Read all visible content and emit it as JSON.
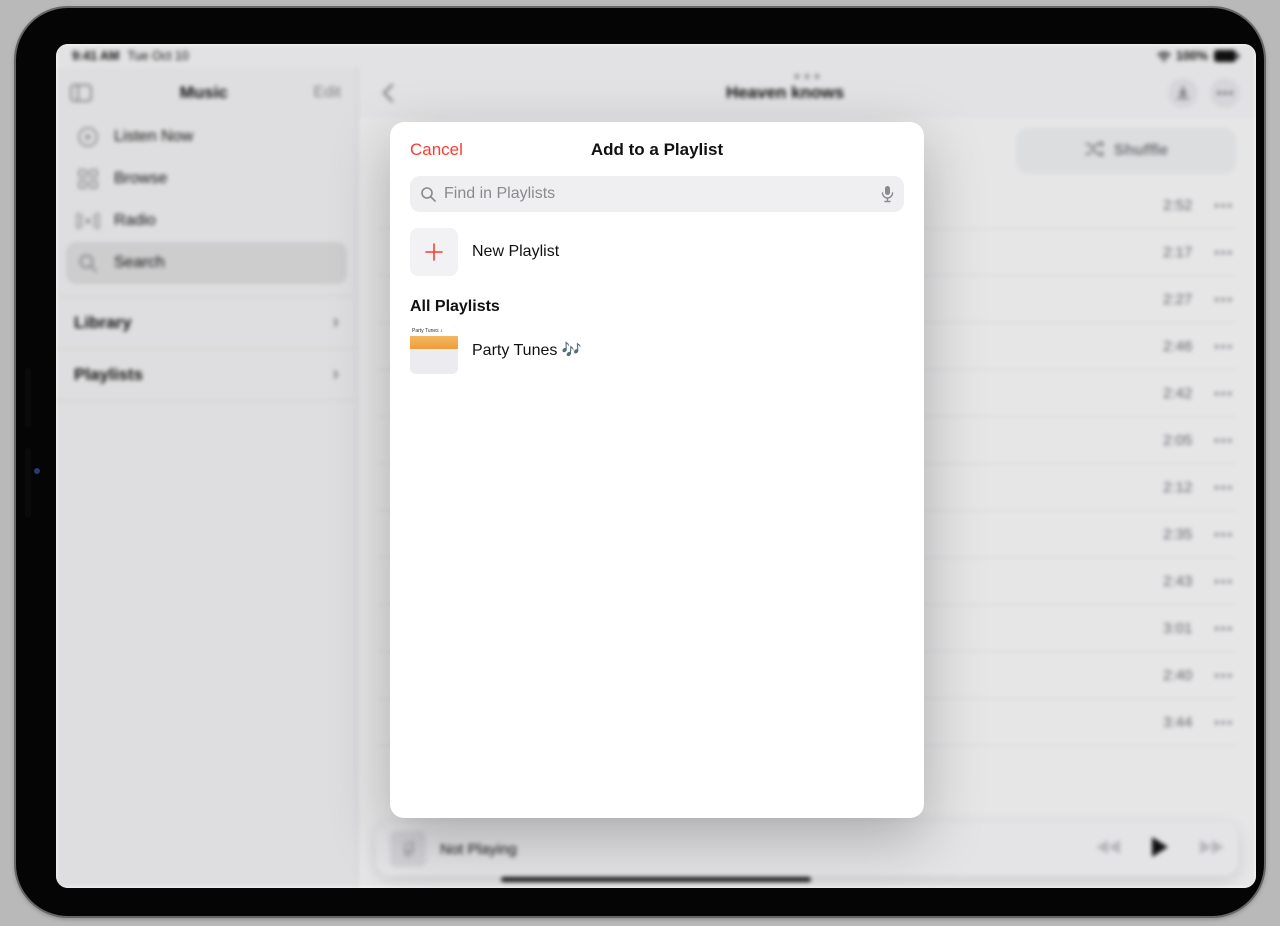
{
  "status": {
    "time": "9:41 AM",
    "date": "Tue Oct 10",
    "battery_pct": "100%"
  },
  "sidebar": {
    "title": "Music",
    "edit_label": "Edit",
    "items": [
      {
        "label": "Listen Now"
      },
      {
        "label": "Browse"
      },
      {
        "label": "Radio"
      },
      {
        "label": "Search"
      }
    ],
    "library_label": "Library",
    "playlists_label": "Playlists"
  },
  "content": {
    "title": "Heaven knows",
    "shuffle_label": "Shuffle"
  },
  "tracks": [
    {
      "duration": "2:52"
    },
    {
      "duration": "2:17"
    },
    {
      "duration": "2:27"
    },
    {
      "duration": "2:46"
    },
    {
      "duration": "2:42"
    },
    {
      "duration": "2:05"
    },
    {
      "duration": "2:12"
    },
    {
      "duration": "2:35"
    },
    {
      "duration": "2:43"
    },
    {
      "duration": "3:01"
    },
    {
      "duration": "2:40"
    },
    {
      "duration": "3:44"
    }
  ],
  "nowplaying": {
    "label": "Not Playing"
  },
  "modal": {
    "cancel_label": "Cancel",
    "title": "Add to a Playlist",
    "search_placeholder": "Find in Playlists",
    "new_playlist_label": "New Playlist",
    "section_label": "All Playlists",
    "playlists": [
      {
        "name": "Party Tunes 🎶"
      }
    ]
  }
}
